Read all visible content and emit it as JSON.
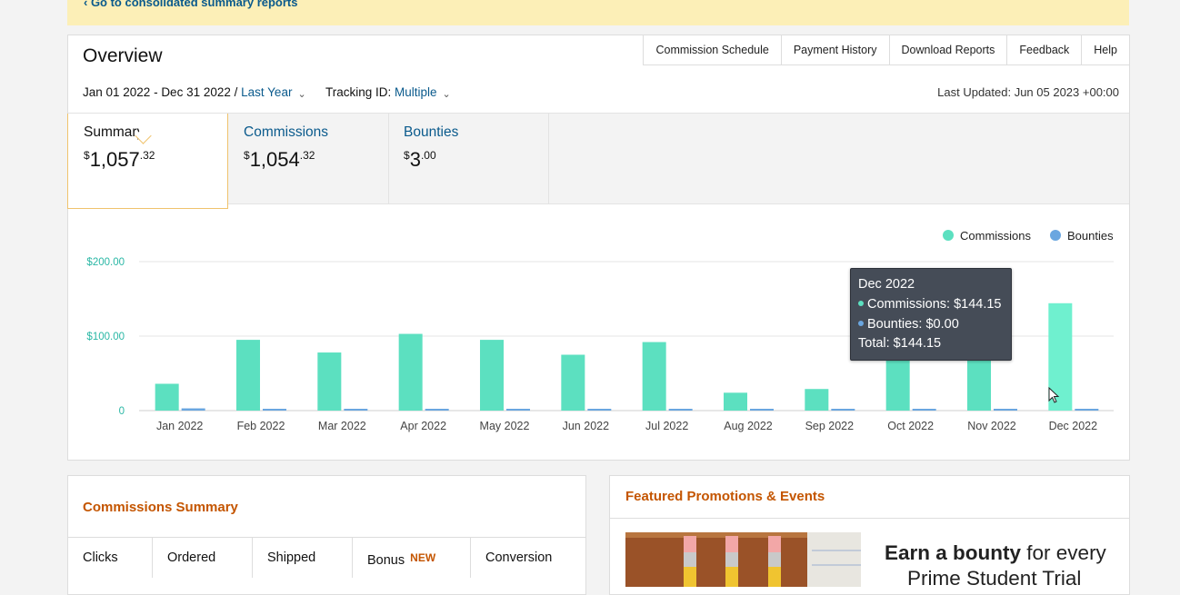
{
  "banner": {
    "link_text": "‹ Go to consolidated summary reports"
  },
  "overview": {
    "title": "Overview",
    "nav": [
      "Commission Schedule",
      "Payment History",
      "Download Reports",
      "Feedback",
      "Help"
    ],
    "date_range": "Jan 01 2022 - Dec 31 2022 /",
    "period": "Last Year",
    "tracking_label": "Tracking ID:",
    "tracking_value": "Multiple",
    "last_updated": "Last Updated: Jun 05 2023 +00:00"
  },
  "tabs": [
    {
      "label": "Summary",
      "currency": "$",
      "whole": "1,057",
      "cents": ".32"
    },
    {
      "label": "Commissions",
      "currency": "$",
      "whole": "1,054",
      "cents": ".32"
    },
    {
      "label": "Bounties",
      "currency": "$",
      "whole": "3",
      "cents": ".00"
    }
  ],
  "colors": {
    "commissions": "#5ce0c0",
    "bounties": "#6aa6e0",
    "accent": "#c45500",
    "link": "#0a5a8c"
  },
  "chart_data": {
    "type": "bar",
    "categories": [
      "Jan 2022",
      "Feb 2022",
      "Mar 2022",
      "Apr 2022",
      "May 2022",
      "Jun 2022",
      "Jul 2022",
      "Aug 2022",
      "Sep 2022",
      "Oct 2022",
      "Nov 2022",
      "Dec 2022"
    ],
    "series": [
      {
        "name": "Commissions",
        "values": [
          36,
          95,
          78,
          103,
          95,
          75,
          92,
          24,
          29,
          70,
          70,
          144.15
        ]
      },
      {
        "name": "Bounties",
        "values": [
          3,
          0,
          0,
          0,
          0,
          0,
          0,
          0,
          0,
          0,
          0,
          0
        ]
      }
    ],
    "ytick_labels": [
      "0",
      "$100.00",
      "$200.00"
    ],
    "ylim": [
      0,
      200
    ],
    "legend_position": "top-right",
    "grid": true
  },
  "tooltip": {
    "title": "Dec 2022",
    "line1": "Commissions: $144.15",
    "line2": "Bounties: $0.00",
    "line3": "Total: $144.15"
  },
  "commissions_summary": {
    "title": "Commissions Summary",
    "columns": [
      "Clicks",
      "Ordered",
      "Shipped",
      "Bonus",
      "Conversion"
    ],
    "bonus_badge": "NEW"
  },
  "promotions": {
    "title": "Featured Promotions & Events",
    "line1_bold": "Earn a bounty",
    "line1_rest": " for every",
    "line2": "Prime Student Trial"
  }
}
